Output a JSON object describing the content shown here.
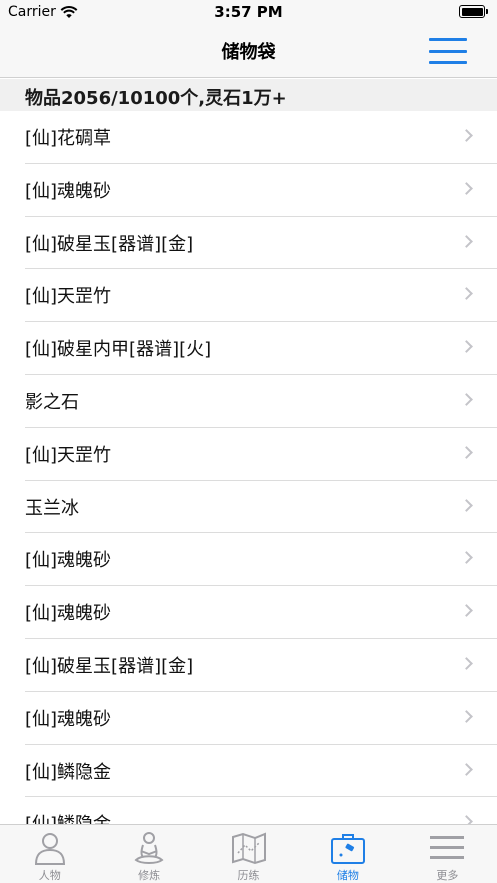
{
  "status_bar": {
    "carrier": "Carrier",
    "time": "3:57 PM",
    "battery_level": 1.0
  },
  "nav": {
    "title": "储物袋",
    "menu_icon": "hamburger-menu-icon"
  },
  "summary": {
    "text": "物品2056/10100个,灵石1万+"
  },
  "items": [
    {
      "label": "[仙]花碉草"
    },
    {
      "label": "[仙]魂魄砂"
    },
    {
      "label": "[仙]破星玉[器谱][金]"
    },
    {
      "label": "[仙]天罡竹"
    },
    {
      "label": "[仙]破星内甲[器谱][火]"
    },
    {
      "label": "影之石"
    },
    {
      "label": "[仙]天罡竹"
    },
    {
      "label": "玉兰冰"
    },
    {
      "label": "[仙]魂魄砂"
    },
    {
      "label": "[仙]魂魄砂"
    },
    {
      "label": "[仙]破星玉[器谱][金]"
    },
    {
      "label": "[仙]魂魄砂"
    },
    {
      "label": "[仙]鳞隐金"
    },
    {
      "label": "[仙]鳞隐金"
    }
  ],
  "tabs": [
    {
      "label": "人物",
      "icon": "person-icon",
      "active": false
    },
    {
      "label": "修炼",
      "icon": "meditation-icon",
      "active": false
    },
    {
      "label": "历练",
      "icon": "map-icon",
      "active": false
    },
    {
      "label": "储物",
      "icon": "briefcase-icon",
      "active": true
    },
    {
      "label": "更多",
      "icon": "more-lines-icon",
      "active": false
    }
  ],
  "colors": {
    "accent": "#1f7fe6",
    "inactive": "#8e8e93",
    "separator": "#dcdcdc"
  }
}
